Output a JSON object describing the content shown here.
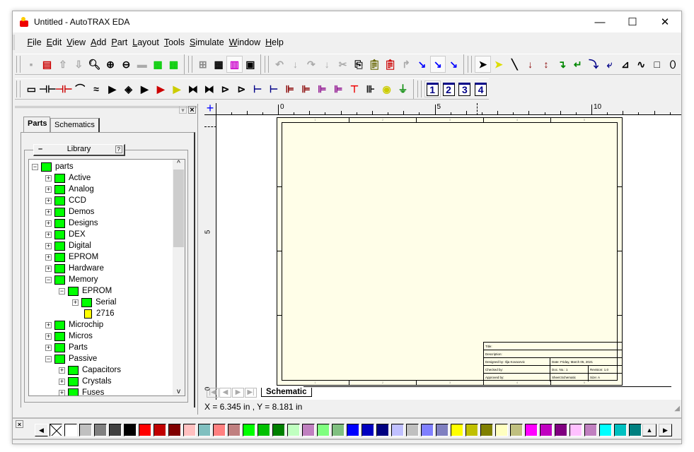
{
  "window": {
    "title": "Untitled - AutoTRAX EDA",
    "minimize": "—",
    "maximize": "☐",
    "close": "✕"
  },
  "menu": [
    "File",
    "Edit",
    "View",
    "Add",
    "Part",
    "Layout",
    "Tools",
    "Simulate",
    "Window",
    "Help"
  ],
  "toolbar1": {
    "groups": [
      [
        [
          "save-icon",
          "▪",
          "#aaa"
        ],
        [
          "new-schematic-icon",
          "▤",
          "#c00"
        ],
        [
          "upload-icon",
          "⇧",
          "#aaa"
        ],
        [
          "download-icon",
          "⇩",
          "#aaa"
        ],
        [
          "zoom-icon",
          "🔍︎",
          "#000"
        ],
        [
          "zoom-in-icon",
          "⊕",
          "#000"
        ],
        [
          "zoom-out-icon",
          "⊖",
          "#000"
        ],
        [
          "stamp-icon",
          "▬",
          "#aaa"
        ],
        [
          "pcb-icon",
          "▦",
          "#0c0"
        ],
        [
          "pcb-flash-icon",
          "▦",
          "#0c0"
        ]
      ],
      [
        [
          "grid-4-icon",
          "⊞",
          "#888"
        ],
        [
          "grid-6-icon",
          "▦",
          "#000"
        ],
        [
          "library-icon",
          "▥",
          "#c0c",
          true
        ],
        [
          "xy-window-icon",
          "▣",
          "#000"
        ]
      ],
      [
        [
          "undo-icon",
          "↶",
          "#aaa"
        ],
        [
          "down-arrow-icon",
          "↓",
          "#aaa"
        ],
        [
          "redo-icon",
          "↷",
          "#aaa"
        ],
        [
          "down-arrow-2-icon",
          "↓",
          "#aaa"
        ],
        [
          "cut-icon",
          "✂",
          "#aaa"
        ],
        [
          "copy-icon",
          "⎘",
          "#000"
        ],
        [
          "paste-icon",
          "📋︎",
          "#660"
        ],
        [
          "paste-red-icon",
          "📋︎",
          "#c00"
        ],
        [
          "rotate-90-icon",
          "↱",
          "#aaa"
        ],
        [
          "route-1-icon",
          "↘",
          "#00f"
        ],
        [
          "route-2-icon",
          "↘",
          "#00f",
          true
        ],
        [
          "route-4-icon",
          "↘",
          "#00f"
        ]
      ],
      [
        [
          "select-arrow-icon",
          "➤",
          "#000",
          true
        ],
        [
          "yellow-arrow-icon",
          "➤",
          "#dd0"
        ],
        [
          "line-icon",
          "╲",
          "#000"
        ],
        [
          "arrow-down-red-icon",
          "↓",
          "#800"
        ],
        [
          "arrow-updown-red-icon",
          "↕",
          "#800"
        ],
        [
          "bend-green-icon",
          "↴",
          "#080"
        ],
        [
          "bend-green-back-icon",
          "↵",
          "#080"
        ],
        [
          "curve-blue-icon",
          "⤵",
          "#008"
        ],
        [
          "curve-blue-back-icon",
          "⤶",
          "#008"
        ],
        [
          "polyline-icon",
          "⊿",
          "#000"
        ],
        [
          "wave-icon",
          "∿",
          "#000"
        ],
        [
          "rectangle-icon",
          "□",
          "#000"
        ],
        [
          "ellipse-icon",
          "⬯",
          "#000"
        ]
      ]
    ]
  },
  "toolbar2": {
    "groups": [
      [
        [
          "resistor-icon",
          "▭",
          "#000"
        ],
        [
          "capacitor-icon",
          "⊣⊢",
          "#000"
        ],
        [
          "polar-capacitor-icon",
          "⊣⊢",
          "#c00"
        ],
        [
          "inductor-icon",
          "⌒",
          "#000"
        ],
        [
          "transformer-icon",
          "≈",
          "#000"
        ],
        [
          "diode-icon",
          "▶",
          "#000"
        ],
        [
          "bridge-icon",
          "◈",
          "#000"
        ],
        [
          "zener-icon",
          "▶",
          "#000"
        ],
        [
          "led-icon",
          "▶",
          "#c00"
        ],
        [
          "photodiode-icon",
          "▶",
          "#cc0"
        ],
        [
          "diac-icon",
          "⧓",
          "#000"
        ],
        [
          "triac-icon",
          "⧓",
          "#000"
        ],
        [
          "npn-icon",
          "⊳",
          "#000"
        ],
        [
          "pnp-icon",
          "⊳",
          "#000"
        ],
        [
          "njfet-icon",
          "⊢",
          "#008"
        ],
        [
          "pjfet-icon",
          "⊢",
          "#008"
        ],
        [
          "nmos-icon",
          "⊫",
          "#800"
        ],
        [
          "pmos-icon",
          "⊫",
          "#800"
        ],
        [
          "nmos-dep-icon",
          "⊫",
          "#808"
        ],
        [
          "pmos-dep-icon",
          "⊫",
          "#808"
        ],
        [
          "vcc-icon",
          "⊤",
          "#e00"
        ],
        [
          "battery-icon",
          "⊪",
          "#000"
        ],
        [
          "ac-source-icon",
          "◉",
          "#cc0"
        ],
        [
          "ground-icon",
          "⏚",
          "#080"
        ]
      ],
      [
        [
          "sheet-1-icon",
          "1",
          "#008",
          true
        ],
        [
          "sheet-2-icon",
          "2",
          "#008"
        ],
        [
          "sheet-3-icon",
          "3",
          "#008"
        ],
        [
          "sheet-4-icon",
          "4",
          "#008"
        ]
      ]
    ]
  },
  "panel": {
    "tabs": [
      "Parts",
      "Schematics"
    ],
    "library_label": "Library",
    "library_minus": "–",
    "library_help": "?",
    "close": "×",
    "pin": "▾"
  },
  "tree": [
    {
      "label": "parts",
      "depth": 0,
      "pm": "−",
      "type": "folder"
    },
    {
      "label": "Active",
      "depth": 1,
      "pm": "+",
      "type": "folder"
    },
    {
      "label": "Analog",
      "depth": 1,
      "pm": "+",
      "type": "folder"
    },
    {
      "label": "CCD",
      "depth": 1,
      "pm": "+",
      "type": "folder"
    },
    {
      "label": "Demos",
      "depth": 1,
      "pm": "+",
      "type": "folder"
    },
    {
      "label": "Designs",
      "depth": 1,
      "pm": "+",
      "type": "folder"
    },
    {
      "label": "DEX",
      "depth": 1,
      "pm": "+",
      "type": "folder"
    },
    {
      "label": "Digital",
      "depth": 1,
      "pm": "+",
      "type": "folder"
    },
    {
      "label": "EPROM",
      "depth": 1,
      "pm": "+",
      "type": "folder"
    },
    {
      "label": "Hardware",
      "depth": 1,
      "pm": "+",
      "type": "folder"
    },
    {
      "label": "Memory",
      "depth": 1,
      "pm": "−",
      "type": "folder"
    },
    {
      "label": "EPROM",
      "depth": 2,
      "pm": "−",
      "type": "folder"
    },
    {
      "label": "Serial",
      "depth": 3,
      "pm": "+",
      "type": "folder"
    },
    {
      "label": "2716",
      "depth": 3,
      "pm": "",
      "type": "part"
    },
    {
      "label": "Microchip",
      "depth": 1,
      "pm": "+",
      "type": "folder"
    },
    {
      "label": "Micros",
      "depth": 1,
      "pm": "+",
      "type": "folder"
    },
    {
      "label": "Parts",
      "depth": 1,
      "pm": "+",
      "type": "folder"
    },
    {
      "label": "Passive",
      "depth": 1,
      "pm": "−",
      "type": "folder"
    },
    {
      "label": "Capacitors",
      "depth": 2,
      "pm": "+",
      "type": "folder"
    },
    {
      "label": "Crystals",
      "depth": 2,
      "pm": "+",
      "type": "folder"
    },
    {
      "label": "Fuses",
      "depth": 2,
      "pm": "+",
      "type": "folder"
    }
  ],
  "ruler": {
    "h_labels": [
      "0",
      "5",
      "10"
    ],
    "v_labels": [
      "5",
      "0"
    ],
    "zones": [
      "1",
      "2",
      "3",
      "4",
      "5"
    ]
  },
  "title_block": {
    "title": "Title:",
    "description": "Description:",
    "designed_by": "Designed by: Ilija Kovacevic",
    "date": "Date: Friday, March 05, 2021",
    "checked_by": "Checked by:",
    "doc_no": "Doc. No.: 1",
    "revision": "Revision: 1.0",
    "approved_by": "Approved by:",
    "sheet": "Sheet:Schematic",
    "size": "Size: A"
  },
  "sheet_tab": "Schematic",
  "status": "X = 6.345 in , Y = 8.181 in",
  "palette": [
    "#ffffff",
    "#c0c0c0",
    "#808080",
    "#404040",
    "#000000",
    "#ff0000",
    "#c00000",
    "#800000",
    "#ffc0c0",
    "#80c0c0",
    "#ff8080",
    "#c08080",
    "#00ff00",
    "#00c000",
    "#008000",
    "#c0ffc0",
    "#c080c0",
    "#80ff80",
    "#80c080",
    "#0000ff",
    "#0000c0",
    "#000080",
    "#c0c0ff",
    "#c0c0c0",
    "#8080ff",
    "#8080c0",
    "#ffff00",
    "#c0c000",
    "#808000",
    "#ffffc0",
    "#c0c080",
    "#ff00ff",
    "#c000c0",
    "#800080",
    "#ffc0ff",
    "#c080c0",
    "#00ffff",
    "#00c0c0",
    "#008080"
  ]
}
